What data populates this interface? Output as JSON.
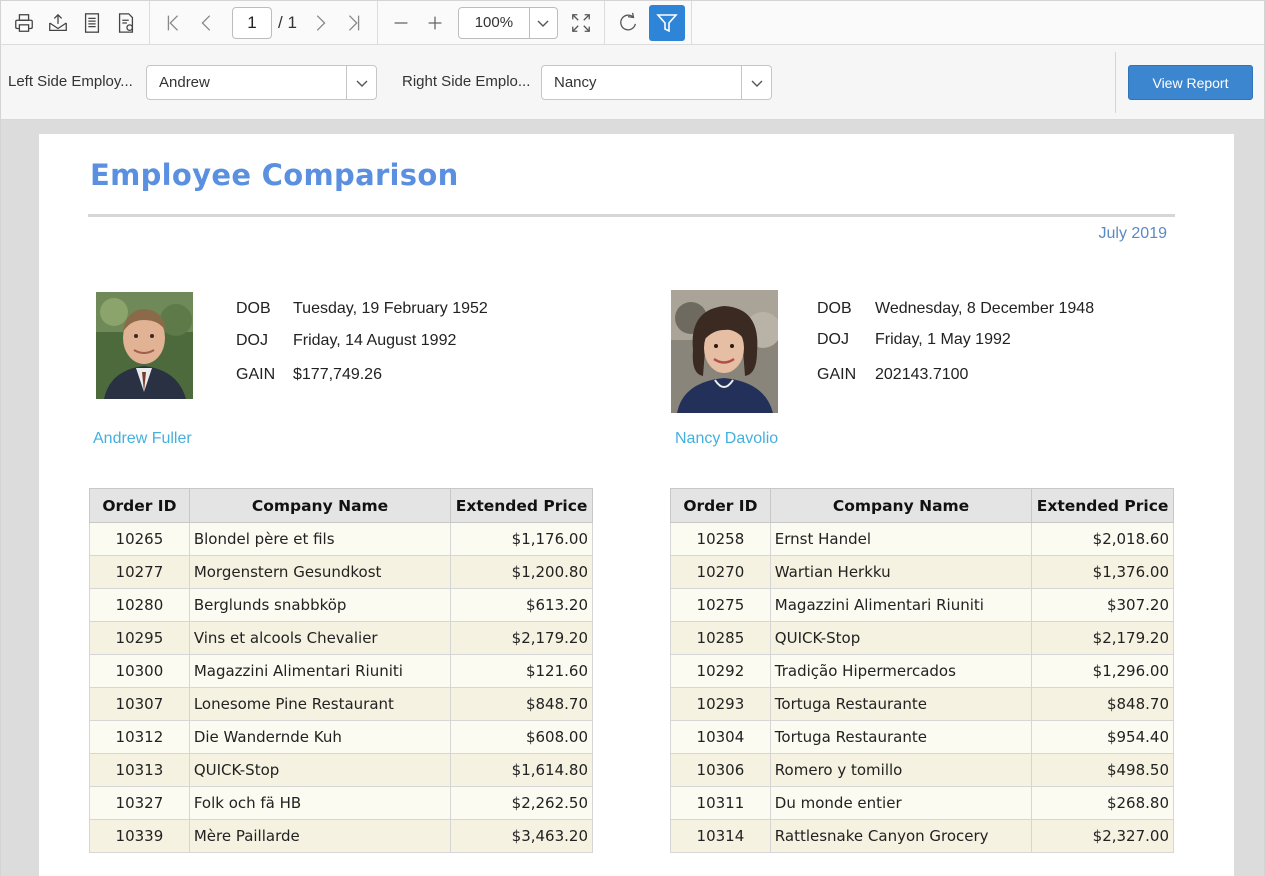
{
  "toolbar": {
    "page_current": "1",
    "page_total": "/ 1",
    "zoom": "100%"
  },
  "params": {
    "left_label": "Left Side Employ...",
    "left_value": "Andrew",
    "right_label": "Right Side Emplo...",
    "right_value": "Nancy",
    "view_report": "View Report"
  },
  "report": {
    "title": "Employee Comparison",
    "date": "July 2019",
    "left": {
      "name": "Andrew  Fuller",
      "dob_label": "DOB",
      "dob": "Tuesday, 19 February 1952",
      "doj_label": "DOJ",
      "doj": "Friday, 14 August 1992",
      "gain_label": "GAIN",
      "gain": "$177,749.26",
      "table": {
        "headers": [
          "Order ID",
          "Company Name",
          "Extended Price"
        ],
        "rows": [
          [
            "10265",
            "Blondel père et fils",
            "$1,176.00"
          ],
          [
            "10277",
            "Morgenstern Gesundkost",
            "$1,200.80"
          ],
          [
            "10280",
            "Berglunds snabbköp",
            "$613.20"
          ],
          [
            "10295",
            "Vins et alcools Chevalier",
            "$2,179.20"
          ],
          [
            "10300",
            "Magazzini Alimentari Riuniti",
            "$121.60"
          ],
          [
            "10307",
            "Lonesome Pine Restaurant",
            "$848.70"
          ],
          [
            "10312",
            "Die Wandernde Kuh",
            "$608.00"
          ],
          [
            "10313",
            "QUICK-Stop",
            "$1,614.80"
          ],
          [
            "10327",
            "Folk och fä HB",
            "$2,262.50"
          ],
          [
            "10339",
            "Mère Paillarde",
            "$3,463.20"
          ]
        ]
      }
    },
    "right": {
      "name": "Nancy  Davolio",
      "dob_label": "DOB",
      "dob": "Wednesday, 8 December 1948",
      "doj_label": "DOJ",
      "doj": "Friday, 1 May 1992",
      "gain_label": "GAIN",
      "gain": "202143.7100",
      "table": {
        "headers": [
          "Order ID",
          "Company Name",
          "Extended Price"
        ],
        "rows": [
          [
            "10258",
            "Ernst Handel",
            "$2,018.60"
          ],
          [
            "10270",
            "Wartian Herkku",
            "$1,376.00"
          ],
          [
            "10275",
            "Magazzini Alimentari Riuniti",
            "$307.20"
          ],
          [
            "10285",
            "QUICK-Stop",
            "$2,179.20"
          ],
          [
            "10292",
            "Tradição Hipermercados",
            "$1,296.00"
          ],
          [
            "10293",
            "Tortuga Restaurante",
            "$848.70"
          ],
          [
            "10304",
            "Tortuga Restaurante",
            "$954.40"
          ],
          [
            "10306",
            "Romero y tomillo",
            "$498.50"
          ],
          [
            "10311",
            "Du monde entier",
            "$268.80"
          ],
          [
            "10314",
            "Rattlesnake Canyon Grocery",
            "$2,327.00"
          ]
        ]
      }
    }
  },
  "colors": {
    "accent": "#2e85d8",
    "title": "#5b8fe0",
    "name": "#44b0e0",
    "date": "#5a8ac4"
  },
  "icons": [
    "print-icon",
    "export-icon",
    "page-setup-icon",
    "print-layout-icon",
    "first-page-icon",
    "previous-page-icon",
    "next-page-icon",
    "last-page-icon",
    "zoom-out-icon",
    "zoom-in-icon",
    "fit-page-icon",
    "refresh-icon",
    "filter-icon"
  ]
}
